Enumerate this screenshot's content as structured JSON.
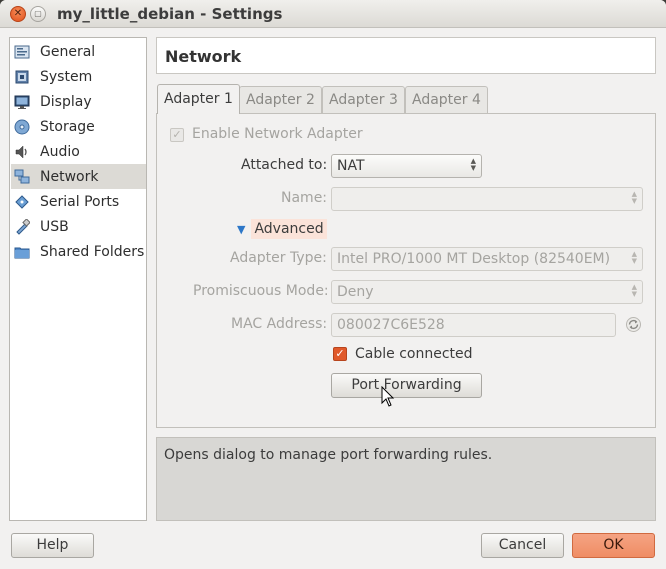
{
  "window": {
    "title": "my_little_debian - Settings"
  },
  "sidebar": {
    "items": [
      {
        "label": "General",
        "icon": "general-icon"
      },
      {
        "label": "System",
        "icon": "system-icon"
      },
      {
        "label": "Display",
        "icon": "display-icon"
      },
      {
        "label": "Storage",
        "icon": "storage-icon"
      },
      {
        "label": "Audio",
        "icon": "audio-icon"
      },
      {
        "label": "Network",
        "icon": "network-icon",
        "selected": true
      },
      {
        "label": "Serial Ports",
        "icon": "serial-ports-icon"
      },
      {
        "label": "USB",
        "icon": "usb-icon"
      },
      {
        "label": "Shared Folders",
        "icon": "shared-folders-icon"
      }
    ]
  },
  "header": {
    "title": "Network"
  },
  "tabs": [
    {
      "label": "Adapter 1",
      "active": true
    },
    {
      "label": "Adapter 2"
    },
    {
      "label": "Adapter 3"
    },
    {
      "label": "Adapter 4"
    }
  ],
  "adapter": {
    "enable_label": "Enable Network Adapter",
    "enable_checked": true,
    "attached_label": "Attached to:",
    "attached_value": "NAT",
    "name_label": "Name:",
    "name_value": "",
    "advanced_label": "Advanced",
    "adapter_type_label": "Adapter Type:",
    "adapter_type_value": "Intel PRO/1000 MT Desktop (82540EM)",
    "promiscuous_label": "Promiscuous Mode:",
    "promiscuous_value": "Deny",
    "mac_label": "MAC Address:",
    "mac_value": "080027C6E528",
    "cable_label": "Cable connected",
    "cable_checked": true,
    "port_forwarding_label": "Port Forwarding"
  },
  "description": "Opens dialog to manage port forwarding rules.",
  "footer": {
    "help_label": "Help",
    "cancel_label": "Cancel",
    "ok_label": "OK"
  },
  "colors": {
    "accent": "#e0592a",
    "ok_button": "#f09670",
    "selected_row": "#dcdad5"
  }
}
